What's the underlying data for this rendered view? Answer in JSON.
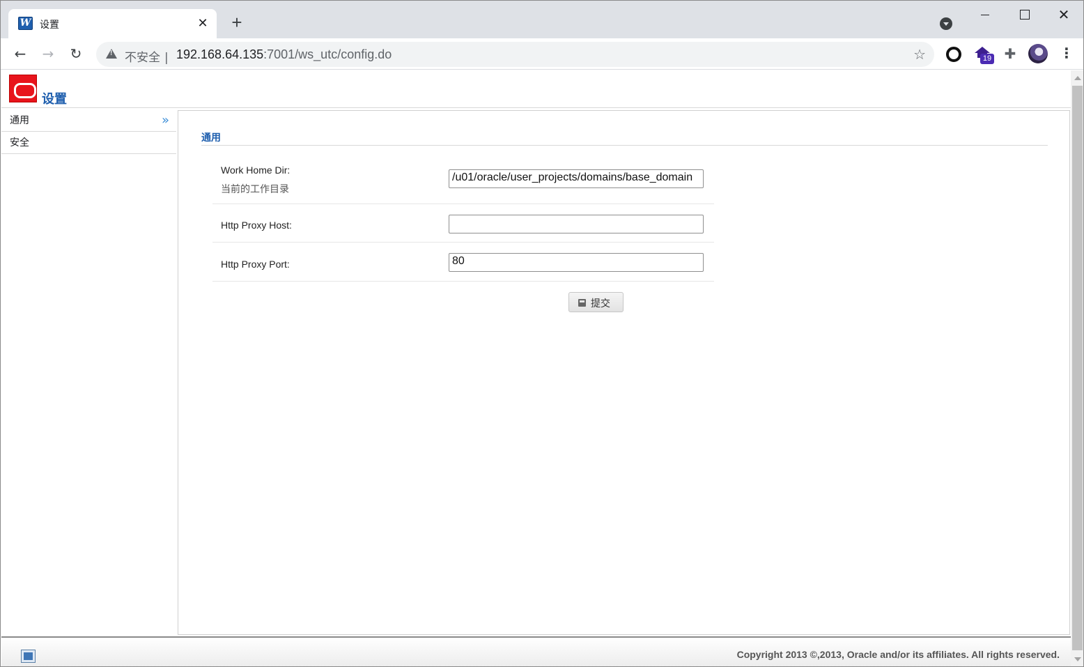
{
  "browser": {
    "tab_title": "设置",
    "tab_favicon_letter": "W",
    "tab_close": "✕",
    "new_tab": "+",
    "window_close": "✕",
    "security_label": "不安全",
    "separator": "|",
    "url_host": "192.168.64.135",
    "url_rest": ":7001/ws_utc/config.do",
    "extension_badge": "19"
  },
  "page": {
    "title": "设置"
  },
  "sidebar": {
    "items": [
      {
        "label": "通用",
        "arrow": "»"
      },
      {
        "label": "安全"
      }
    ]
  },
  "main": {
    "section_title": "通用",
    "fields": [
      {
        "label": "Work Home Dir:",
        "sublabel": "当前的工作目录",
        "value": "/u01/oracle/user_projects/domains/base_domain"
      },
      {
        "label": "Http Proxy Host:",
        "value": ""
      },
      {
        "label": "Http Proxy Port:",
        "value": "80"
      }
    ],
    "submit_label": "提交"
  },
  "footer": {
    "copyright": "Copyright 2013 ©,2013, Oracle and/or its affiliates. All rights reserved."
  },
  "icons": [
    "warning-icon",
    "star-icon",
    "extension-puzzle-icon",
    "save-icon",
    "oracle-logo-icon",
    "double-chevron-right-icon"
  ]
}
